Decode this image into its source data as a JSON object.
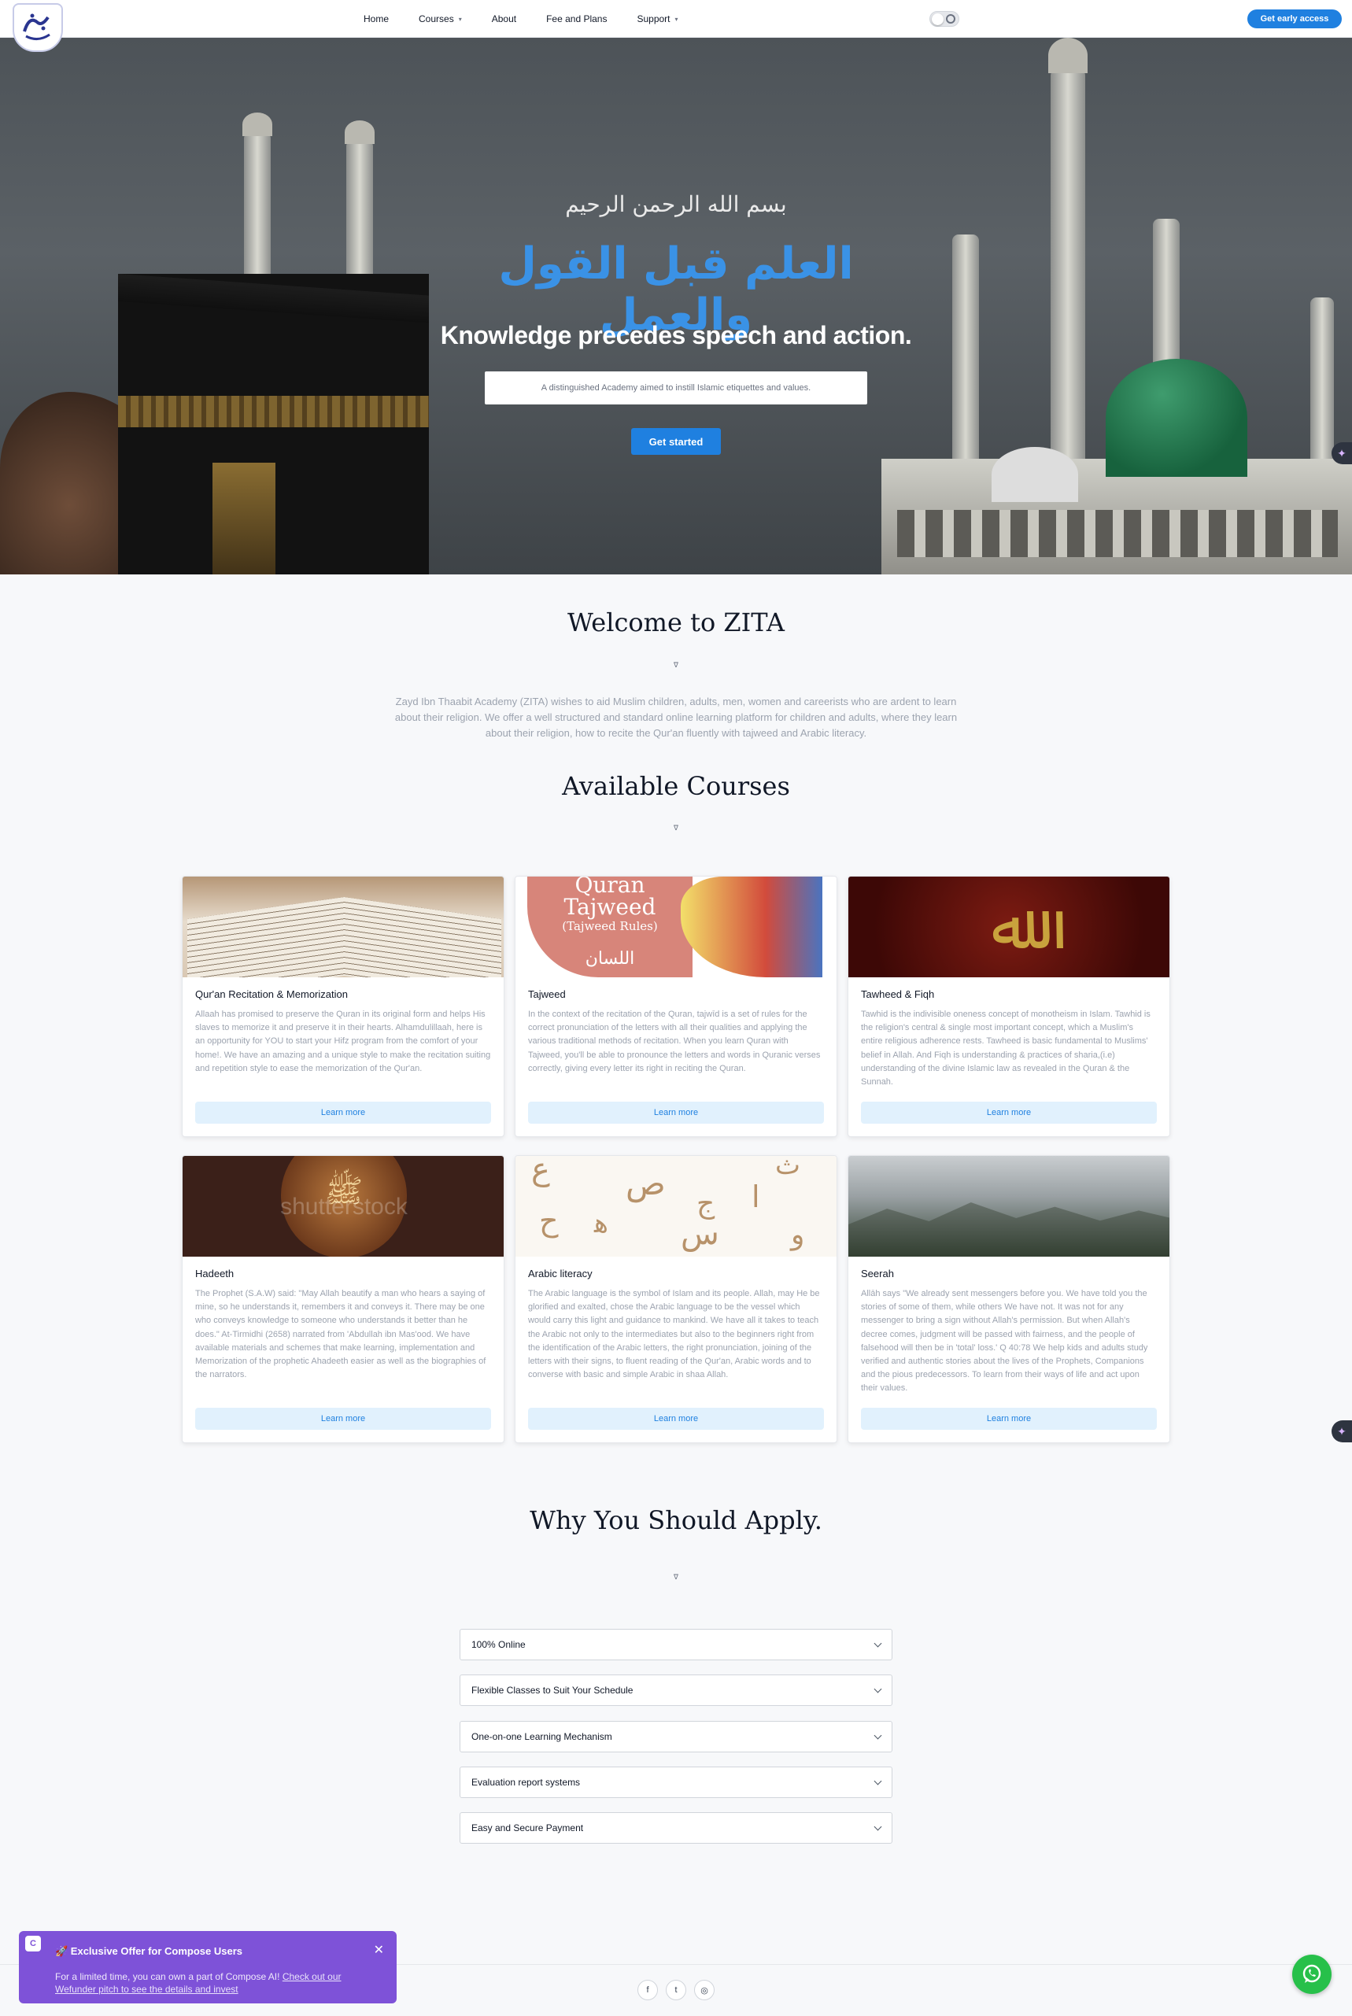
{
  "nav": {
    "logo_icon": "zita-logo",
    "links": [
      {
        "label": "Home",
        "dropdown": false
      },
      {
        "label": "Courses",
        "dropdown": true
      },
      {
        "label": "About",
        "dropdown": false
      },
      {
        "label": "Fee and Plans",
        "dropdown": false
      },
      {
        "label": "Support",
        "dropdown": true
      }
    ],
    "theme_toggle_icon": "moon-icon",
    "cta": "Get early access"
  },
  "hero": {
    "bismillah": "بسم الله الرحمن الرحيم",
    "arabic_title": "العلم قبل القول والعمل",
    "title": "Knowledge precedes speech and action.",
    "subtitle": "A distinguished Academy aimed to instill Islamic etiquettes and values.",
    "cta": "Get started"
  },
  "welcome": {
    "title": "Welcome to ZITA",
    "text": "Zayd Ibn Thaabit Academy (ZITA) wishes to aid Muslim children, adults, men, women and careerists who are ardent to learn about their religion. We offer a well structured and standard online learning platform for children and adults, where they learn about their religion, how to recite the Qur'an fluently with tajweed and Arabic literacy."
  },
  "courses": {
    "title": "Available Courses",
    "items": [
      {
        "title": "Qur'an Recitation & Memorization",
        "text": "Allaah has promised to preserve the Quran in its original form and helps His slaves to memorize it and preserve it in their hearts. Alhamdulillaah, here is an opportunity for YOU to start your Hifz program from the comfort of your home!. We have an amazing and a unique style to make the recitation suiting and repetition style to ease the memorization of the Qur'an.",
        "button": "Learn more"
      },
      {
        "title": "Tajweed",
        "text": "In the context of the recitation of the Quran, tajwīd is a set of rules for the correct pronunciation of the letters with all their qualities and applying the various traditional methods of recitation. When you learn Quran with Tajweed, you'll be able to pronounce the letters and words in Quranic verses correctly, giving every letter its right in reciting the Quran.",
        "button": "Learn more",
        "image_text": [
          "Quran",
          "Tajweed",
          "(Tajweed Rules)",
          "اللسان"
        ]
      },
      {
        "title": "Tawheed & Fiqh",
        "text": "Tawhid is the indivisible oneness concept of monotheism in Islam. Tawhid is the religion's central & single most important concept, which a Muslim's entire religious adherence rests. Tawheed is basic fundamental to Muslims' belief in Allah. And Fiqh is understanding & practices of sharia,(i.e) understanding of the divine Islamic law as revealed in the Quran & the Sunnah.",
        "button": "Learn more"
      },
      {
        "title": "Hadeeth",
        "text": "The Prophet (S.A.W) said: \"May Allah beautify a man who hears a saying of mine, so he understands it, remembers it and conveys it. There may be one who conveys knowledge to someone who understands it better than he does.\" At-Tirmidhi (2658) narrated from 'Abdullah ibn Mas'ood. We have available materials and schemes that make learning, implementation and Memorization of the prophetic Ahadeeth easier as well as the biographies of the narrators.",
        "button": "Learn more",
        "image_text": "shutterstock"
      },
      {
        "title": "Arabic literacy",
        "text": "The Arabic language is the symbol of Islam and its people. Allah, may He be glorified and exalted, chose the Arabic language to be the vessel which would carry this light and guidance to mankind. We have all it takes to teach the Arabic not only to the intermediates but also to the beginners right from the identification of the Arabic letters, the right pronunciation, joining of the letters with their signs, to fluent reading of the Qur'an, Arabic words and to converse with basic and simple Arabic in shaa Allah.",
        "button": "Learn more"
      },
      {
        "title": "Seerah",
        "text": "Allāh says \"We already sent messengers before you. We have told you the stories of some of them, while others We have not. It was not for any messenger to bring a sign without Allah's permission. But when Allah's decree comes, judgment will be passed with fairness, and the people of falsehood will then be in 'total' loss.' Q 40:78 We help kids and adults study verified and authentic stories about the lives of the Prophets, Companions and the pious predecessors. To learn from their ways of life and act upon their values.",
        "button": "Learn more"
      }
    ]
  },
  "why": {
    "title": "Why You Should Apply.",
    "items": [
      "100% Online",
      "Flexible Classes to Suit Your Schedule",
      "One-on-one Learning Mechanism",
      "Evaluation report systems",
      "Easy and Secure Payment"
    ]
  },
  "footer": {
    "socials": [
      "facebook-icon",
      "twitter-icon",
      "instagram-icon"
    ]
  },
  "offer": {
    "icon_letter": "C",
    "title": "🚀 Exclusive Offer for Compose Users",
    "text": "For a limited time, you can own a part of Compose AI!",
    "link": "Check out our Wefunder pitch to see the details and invest",
    "close": "✕"
  },
  "colors": {
    "accent": "#1f80e0",
    "arabic_title": "#3a92e6",
    "offer_bg": "#7e52d8",
    "whatsapp": "#27c04a"
  }
}
